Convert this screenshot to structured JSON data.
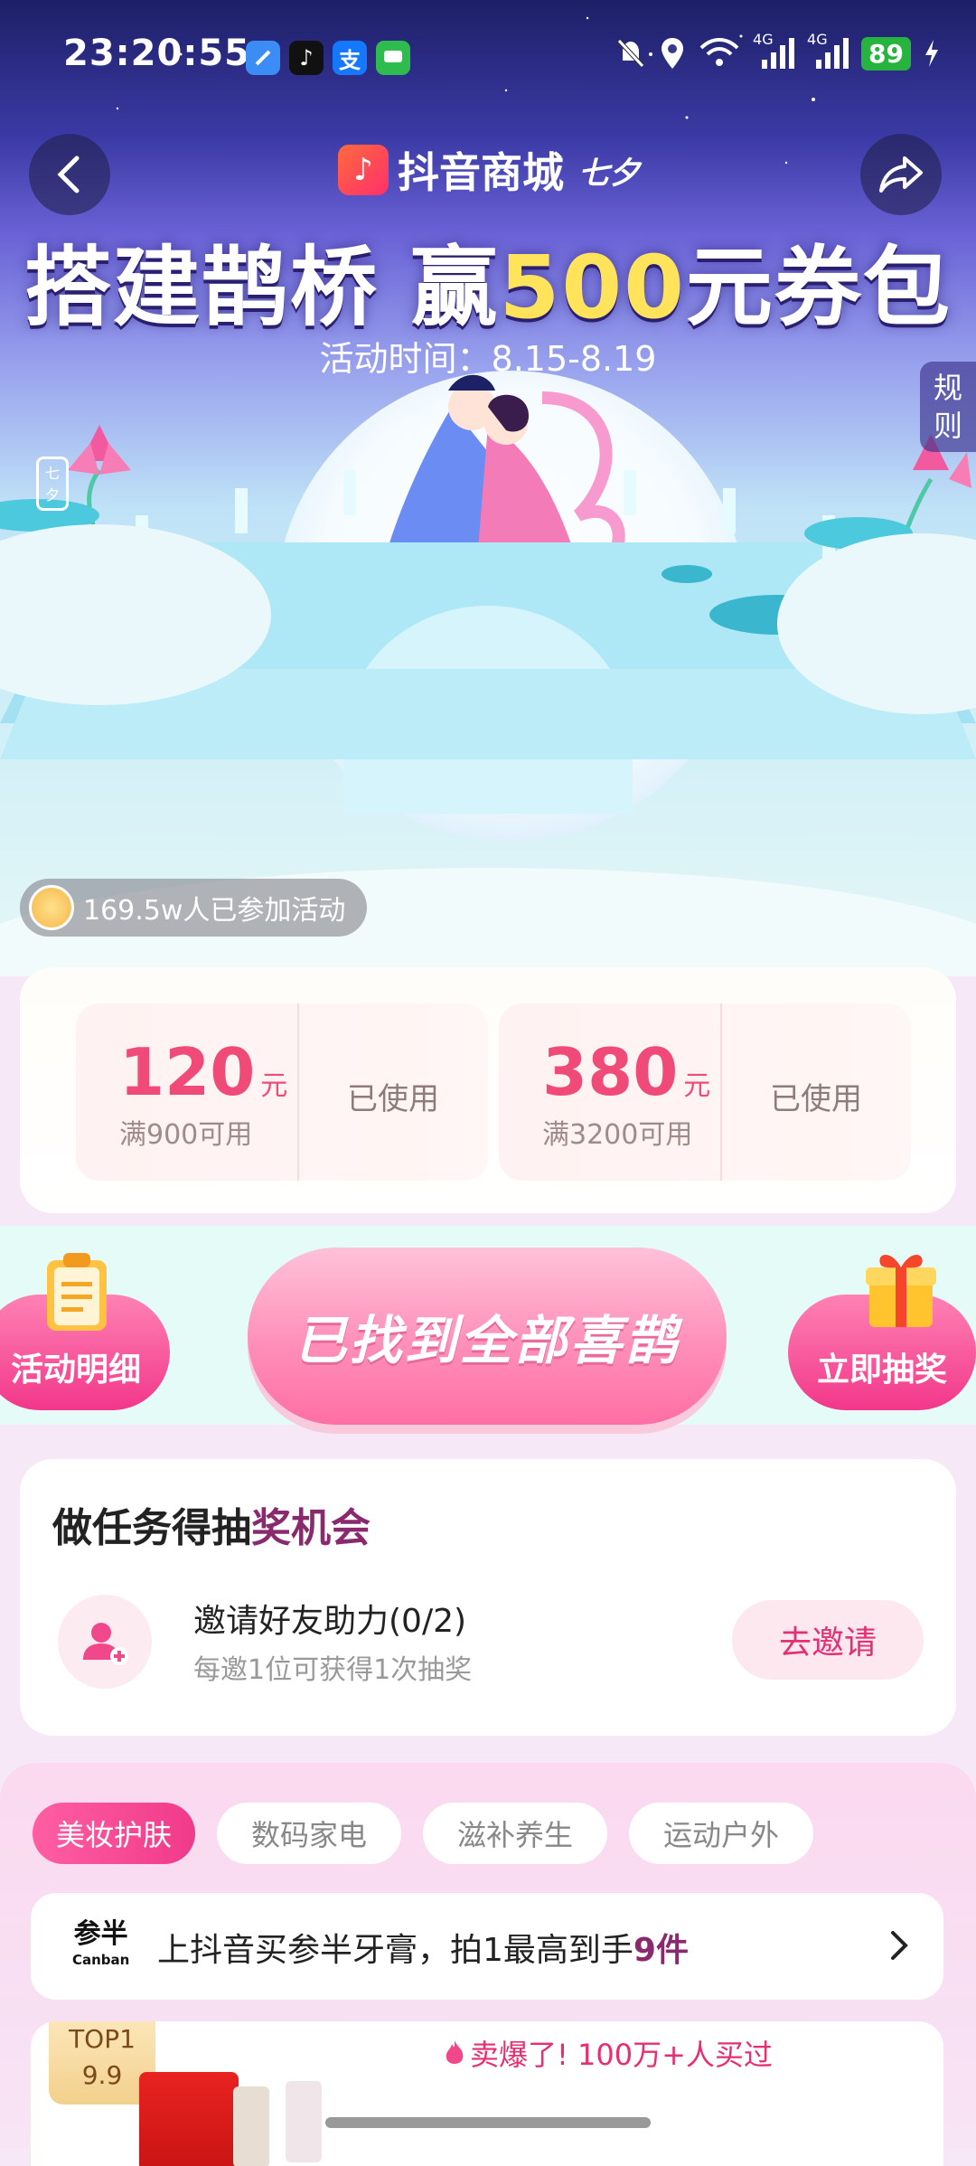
{
  "status_bar": {
    "time": "23:20:55",
    "app_icons": [
      "maps-icon",
      "tiktok-icon",
      "alipay-icon",
      "messages-icon"
    ],
    "alipay_glyph": "支",
    "network_labels": [
      "4G",
      "4G"
    ],
    "battery": "89"
  },
  "header": {
    "brand_text": "抖音商城",
    "brand_logo_text": "七夕"
  },
  "hero": {
    "headline_prefix": "搭建鹊桥 赢",
    "headline_amount": "500",
    "headline_suffix": "元券包",
    "period": "活动时间：8.15-8.19",
    "rules_tab": "规则",
    "participants": "169.5w人已参加活动"
  },
  "coupons": [
    {
      "amount": "120",
      "unit": "元",
      "condition": "满900可用",
      "status": "已使用"
    },
    {
      "amount": "380",
      "unit": "元",
      "condition": "满3200可用",
      "status": "已使用"
    }
  ],
  "actions": {
    "details_label": "活动明细",
    "main_label": "已找到全部喜鹊",
    "lottery_label": "立即抽奖"
  },
  "task_card": {
    "title_prefix": "做任务得抽",
    "title_highlight": "奖机会",
    "task_name": "邀请好友助力(0/2)",
    "task_desc": "每邀1位可获得1次抽奖",
    "button": "去邀请"
  },
  "categories": {
    "items": [
      "美妆护肤",
      "数码家电",
      "滋补养生",
      "运动户外"
    ],
    "selected": "美妆护肤"
  },
  "promo": {
    "brand_cn": "参半",
    "brand_en": "Canban",
    "text_prefix": "上抖音买参半牙膏，拍1最高到手",
    "text_highlight": "9件"
  },
  "product": {
    "badge_rank": "TOP1",
    "badge_price": "9.9",
    "hot_text": "卖爆了! 100万+人买过"
  },
  "colors": {
    "accent_pink": "#f03a8a",
    "coupon_red": "#f04b78",
    "battery_green": "#27b43e",
    "headline_gold": "#ffe35a"
  }
}
